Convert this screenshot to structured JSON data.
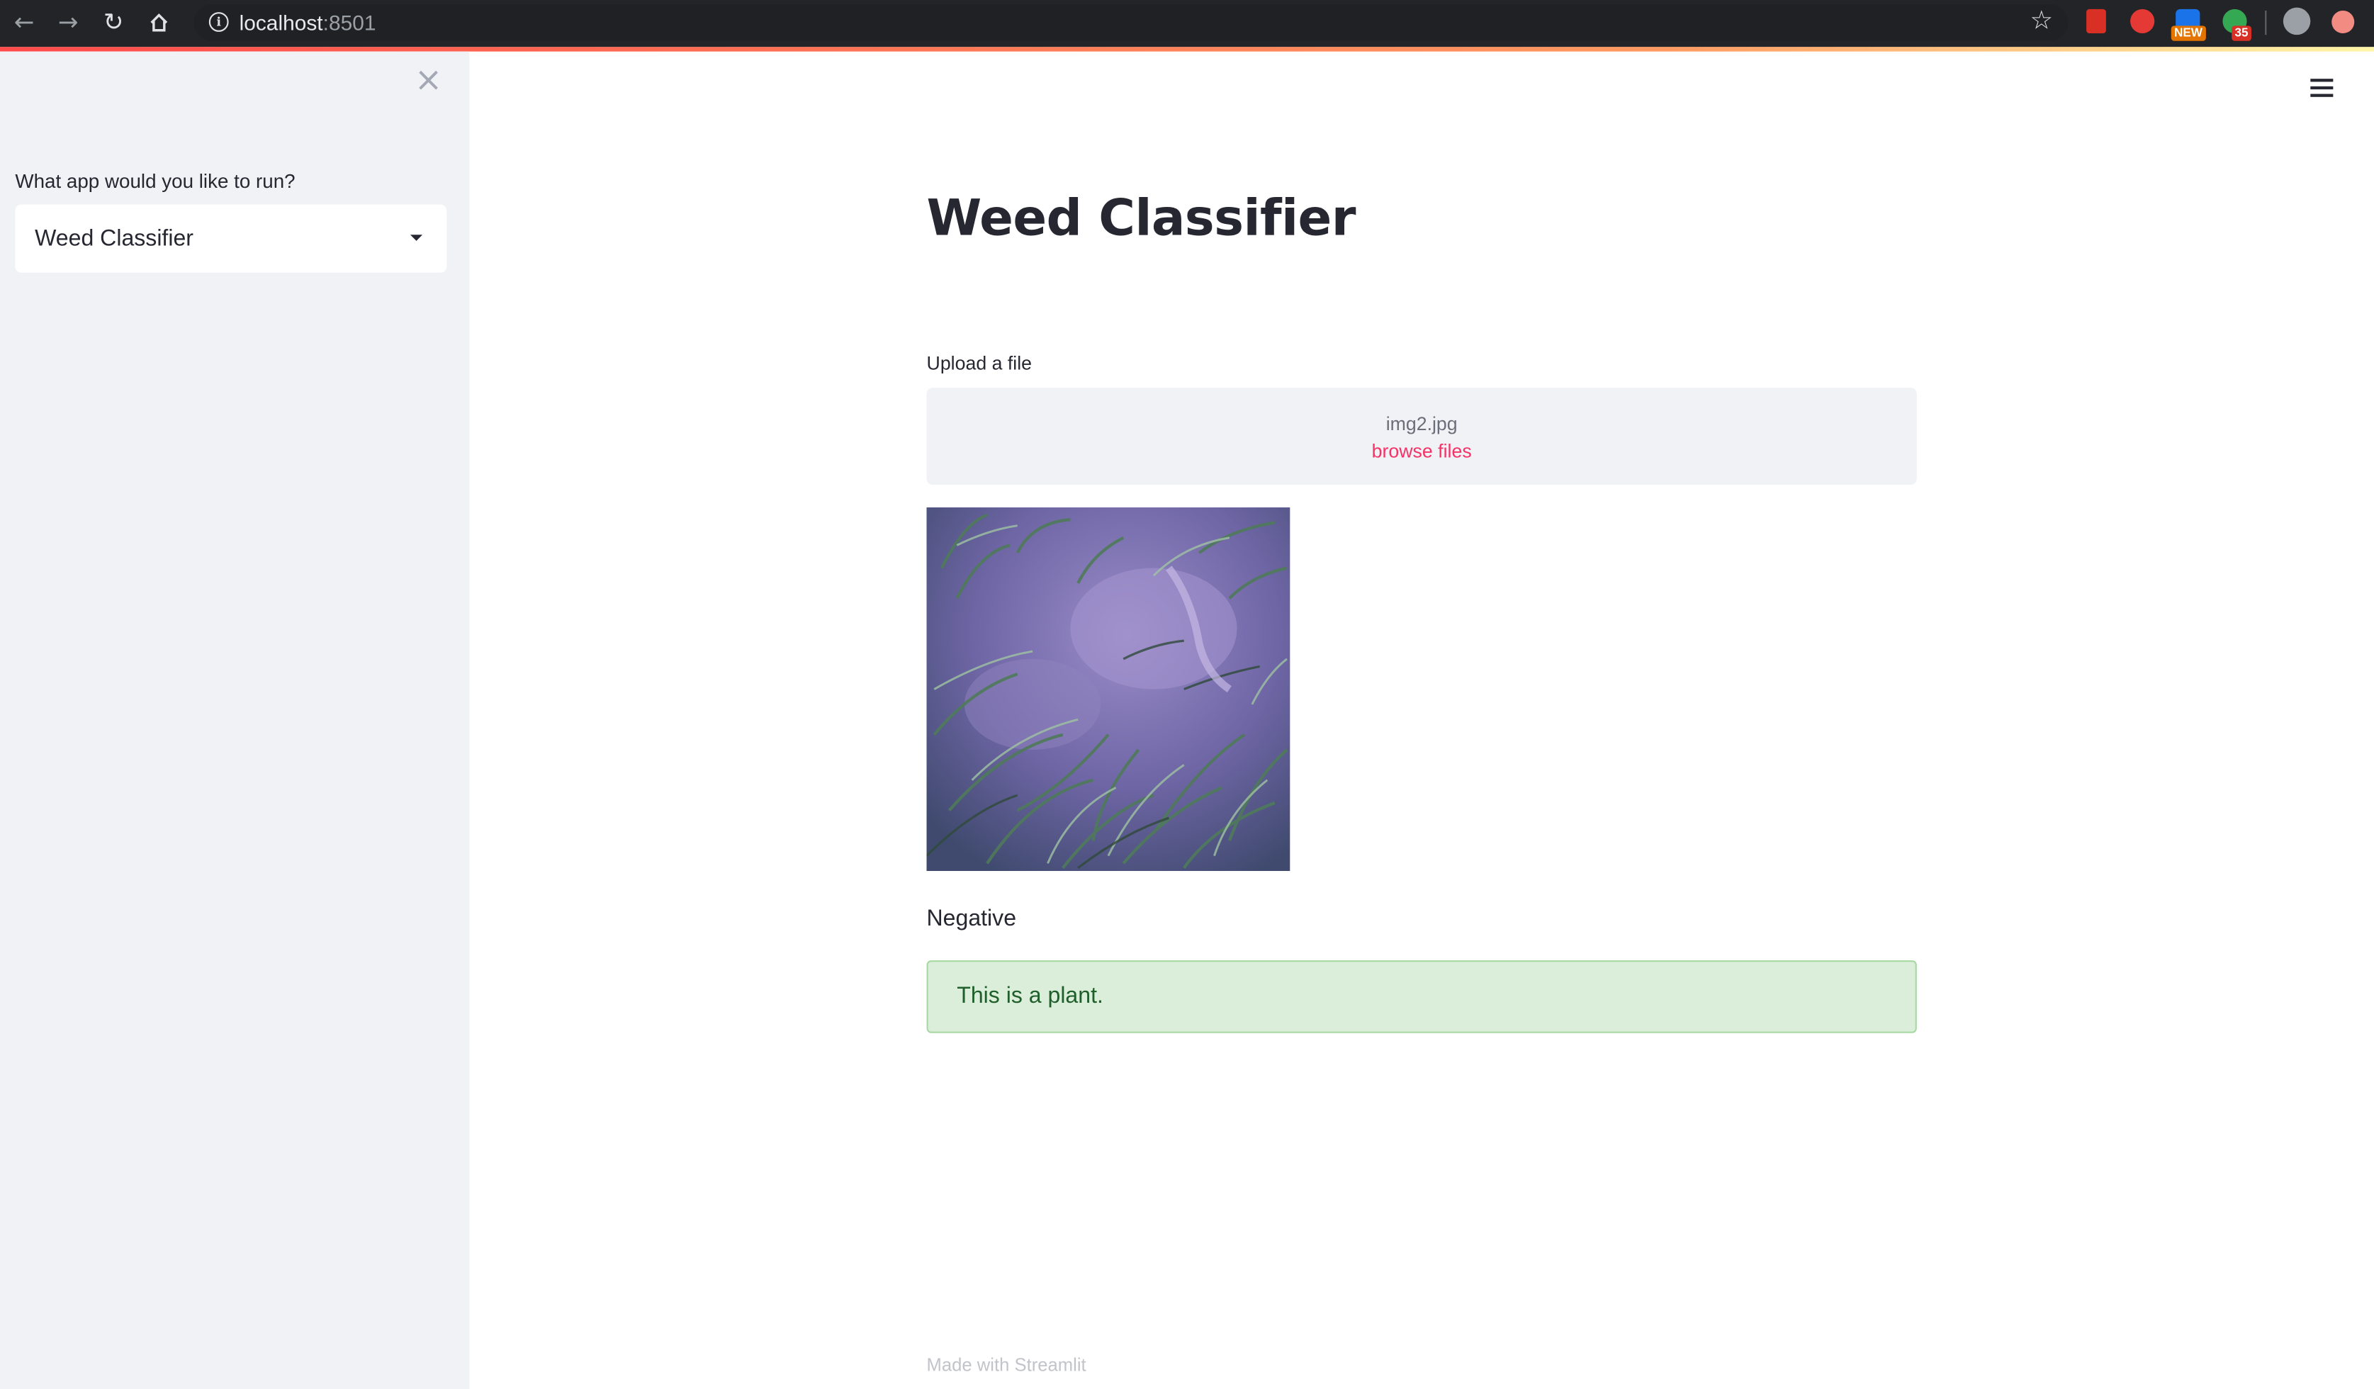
{
  "browser": {
    "url_host": "localhost",
    "url_port": ":8501",
    "back_icon": "arrow-left-icon",
    "forward_icon": "arrow-right-icon",
    "reload_icon": "reload-icon",
    "home_icon": "home-icon",
    "extensions": [
      {
        "name": "bookmark-extension-icon",
        "color": "#d93025"
      },
      {
        "name": "adblock-extension-icon",
        "color": "#e53935"
      },
      {
        "name": "share-extension-icon",
        "color": "#1a73e8",
        "badge": "NEW",
        "badge_color": "#e37400"
      },
      {
        "name": "green-extension-icon",
        "color": "#34a853",
        "badge": "35",
        "badge_color": "#d93025"
      },
      {
        "name": "profile-avatar-icon",
        "color": "#9aa0a6"
      },
      {
        "name": "update-extension-icon",
        "color": "#f28b82"
      }
    ]
  },
  "sidebar": {
    "select_label": "What app would you like to run?",
    "selected_app": "Weed Classifier"
  },
  "main": {
    "title": "Weed Classifier",
    "upload_label": "Upload a file",
    "uploaded_filename": "img2.jpg",
    "browse_label": "browse files",
    "prediction_label": "Negative",
    "success_message": "This is a plant.",
    "footer_text": "Made with Streamlit"
  },
  "colors": {
    "accent": "#f63366",
    "sidebar_bg": "#f0f2f6",
    "success_bg": "#dbeed9",
    "success_text": "#1f5f2b"
  }
}
